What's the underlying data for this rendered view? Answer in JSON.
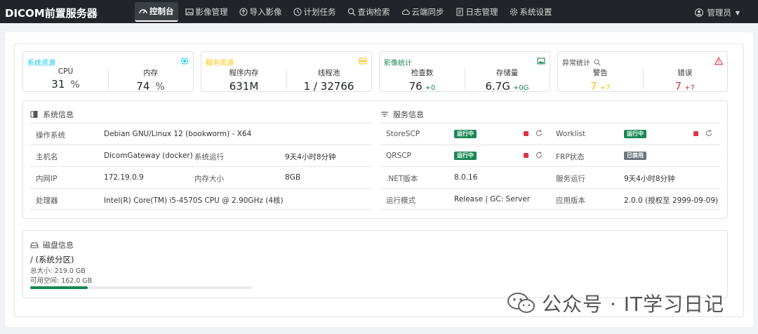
{
  "app": {
    "title": "DICOM前置服务器"
  },
  "nav": [
    {
      "label": "控制台",
      "icon": "dashboard-icon",
      "active": true
    },
    {
      "label": "影像管理",
      "icon": "image-icon"
    },
    {
      "label": "导入影像",
      "icon": "upload-icon"
    },
    {
      "label": "计划任务",
      "icon": "clock-icon"
    },
    {
      "label": "查询检索",
      "icon": "search-icon"
    },
    {
      "label": "云端同步",
      "icon": "cloud-icon"
    },
    {
      "label": "日志管理",
      "icon": "log-icon"
    },
    {
      "label": "系统设置",
      "icon": "gear-icon"
    }
  ],
  "user": {
    "label": "管理员"
  },
  "cards": {
    "system": {
      "title": "系统资源",
      "color": "#0dcaf0",
      "cpu_label": "CPU",
      "cpu_value": "31",
      "cpu_unit": "%",
      "mem_label": "内存",
      "mem_value": "74",
      "mem_unit": "%"
    },
    "service": {
      "title": "服务资源",
      "color": "#ffc107",
      "proc_label": "程序内存",
      "proc_value": "631M",
      "thread_label": "线程池",
      "thread_value": "1 / 32766"
    },
    "image": {
      "title": "影像统计",
      "color": "#198754",
      "exam_label": "检查数",
      "exam_value": "76",
      "exam_delta": "+0",
      "storage_label": "存储量",
      "storage_value": "6.7G",
      "storage_delta": "+0G"
    },
    "anomaly": {
      "title": "异常统计",
      "color": "#dc3545",
      "warn_label": "警告",
      "warn_value": "7",
      "warn_delta": "+7",
      "err_label": "错误",
      "err_value": "7",
      "err_delta": "+7"
    }
  },
  "system_info": {
    "title": "系统信息",
    "os_label": "操作系统",
    "os_value": "Debian GNU/Linux 12 (bookworm) - X64",
    "host_label": "主机名",
    "host_value": "DicomGateway (docker)",
    "uptime_label": "系统运行",
    "uptime_value": "9天4小时8分钟",
    "ip_label": "内网IP",
    "ip_value": "172.19.0.9",
    "memsize_label": "内存大小",
    "memsize_value": "8GB",
    "cpu_label": "处理器",
    "cpu_value": "Intel(R) Core(TM) i5-4570S CPU @ 2.90GHz (4核)"
  },
  "service_info": {
    "title": "服务信息",
    "storescp_label": "StoreSCP",
    "storescp_status": "运行中",
    "worklist_label": "Worklist",
    "worklist_status": "运行中",
    "qrscp_label": "QRSCP",
    "qrscp_status": "运行中",
    "frp_label": "FRP状态",
    "frp_status": "已禁用",
    "net_label": ".NET版本",
    "net_value": "8.0.16",
    "srvuptime_label": "服务运行",
    "srvuptime_value": "9天4小时8分钟",
    "mode_label": "运行模式",
    "mode_value": "Release | GC: Server",
    "appver_label": "应用版本",
    "appver_value": "2.0.0 (授权至 2999-09-09)"
  },
  "disk": {
    "title": "磁盘信息",
    "name": "/ (系统分区)",
    "total": "总大小: 219.0 GB",
    "free": "可用空间: 162.0 GB",
    "used_fraction": 0.26
  },
  "watermark": {
    "text": "公众号 · IT学习日记"
  }
}
